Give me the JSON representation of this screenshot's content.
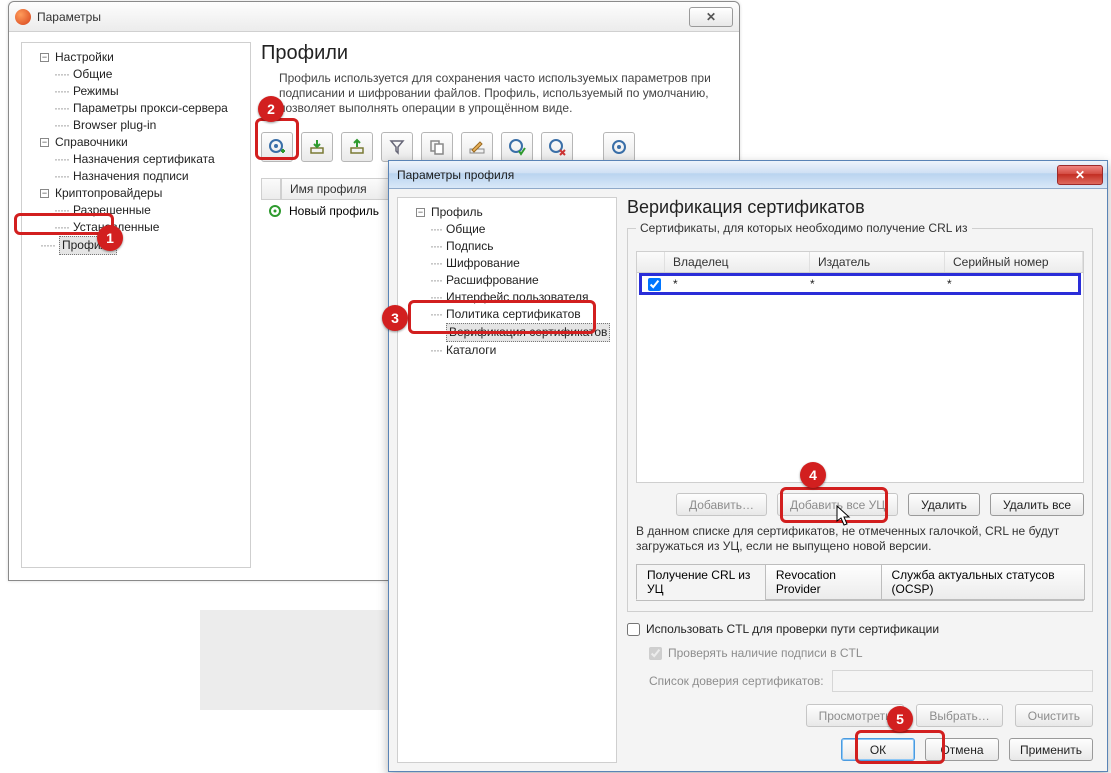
{
  "win1": {
    "title": "Параметры",
    "close_glyph": "✕",
    "heading": "Профили",
    "description": "Профиль используется для сохранения часто используемых параметров при подписании и шифровании файлов. Профиль, используемый по умолчанию, позволяет выполнять операции в упрощённом виде.",
    "tree": {
      "settings": "Настройки",
      "settings_children": [
        "Общие",
        "Режимы",
        "Параметры прокси-сервера",
        "Browser plug-in"
      ],
      "dirs": "Справочники",
      "dirs_children": [
        "Назначения сертификата",
        "Назначения подписи"
      ],
      "crypto": "Криптопровайдеры",
      "crypto_children": [
        "Разрешенные",
        "Установленные"
      ],
      "profiles": "Профили"
    },
    "list_header_name": "Имя профиля",
    "list_row_name": "Новый профиль"
  },
  "win2": {
    "title": "Параметры профиля",
    "close_glyph": "✕",
    "tree": {
      "profile": "Профиль",
      "children": [
        "Общие",
        "Подпись",
        "Шифрование",
        "Расшифрование",
        "Интерфейс пользователя",
        "Политика сертификатов",
        "Верификация сертификатов",
        "Каталоги"
      ]
    },
    "heading": "Верификация сертификатов",
    "fieldset_legend": "Сертификаты, для которых необходимо получение CRL из",
    "columns": {
      "owner": "Владелец",
      "issuer": "Издатель",
      "serial": "Серийный номер"
    },
    "row": {
      "checked": true,
      "owner": "*",
      "issuer": "*",
      "serial": "*"
    },
    "buttons": {
      "add": "Добавить…",
      "add_all": "Добавить все УЦ",
      "delete": "Удалить",
      "delete_all": "Удалить все"
    },
    "note": "В данном списке для сертификатов, не отмеченных галочкой, CRL не будут загружаться из УЦ, если не выпущено новой версии.",
    "tabs": [
      "Получение CRL из УЦ",
      "Revocation Provider",
      "Служба актуальных статусов (OCSP)"
    ],
    "use_ctl": "Использовать CTL для проверки пути сертификации",
    "check_sig": "Проверять наличие подписи в CTL",
    "trust_label": "Список доверия сертификатов:",
    "view": "Просмотреть",
    "choose": "Выбрать…",
    "clear": "Очистить",
    "ok": "ОК",
    "cancel": "Отмена",
    "apply": "Применить"
  },
  "steps": {
    "1": "1",
    "2": "2",
    "3": "3",
    "4": "4",
    "5": "5"
  }
}
